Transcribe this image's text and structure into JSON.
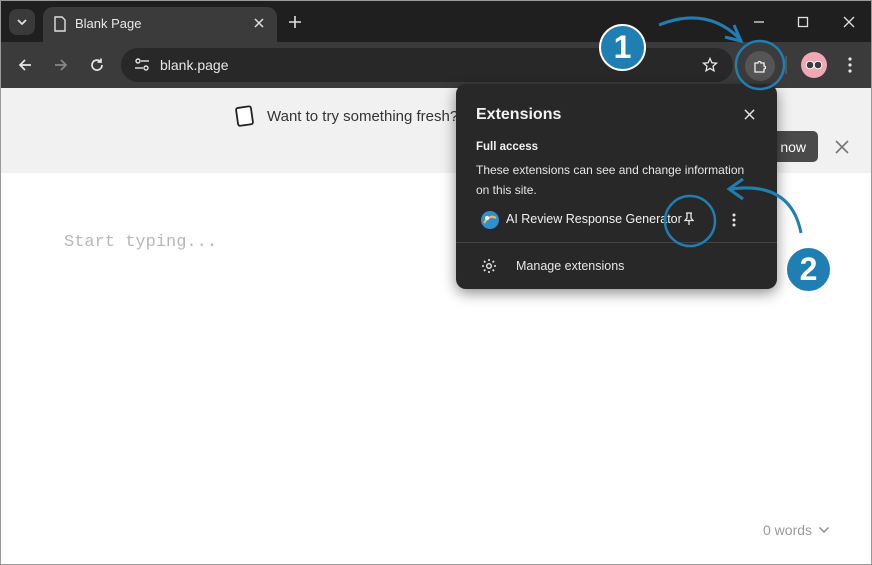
{
  "browser": {
    "tab": {
      "title": "Blank Page"
    },
    "address_bar": {
      "url": "blank.page"
    }
  },
  "banner": {
    "text": "Want to try something fresh?",
    "button_label": "now"
  },
  "editor": {
    "placeholder": "Start typing...",
    "word_count": "0 words"
  },
  "extensions_popup": {
    "title": "Extensions",
    "section_title": "Full access",
    "section_description": "These extensions can see and change information on this site.",
    "extension_name": "AI Review Response Generator",
    "manage_label": "Manage extensions"
  },
  "annotations": {
    "step1": "1",
    "step2": "2",
    "color": "#1f7fb3"
  },
  "colors": {
    "tabstrip": "#1f1f1f",
    "toolbar": "#3b3b3b",
    "popup": "#282828"
  }
}
